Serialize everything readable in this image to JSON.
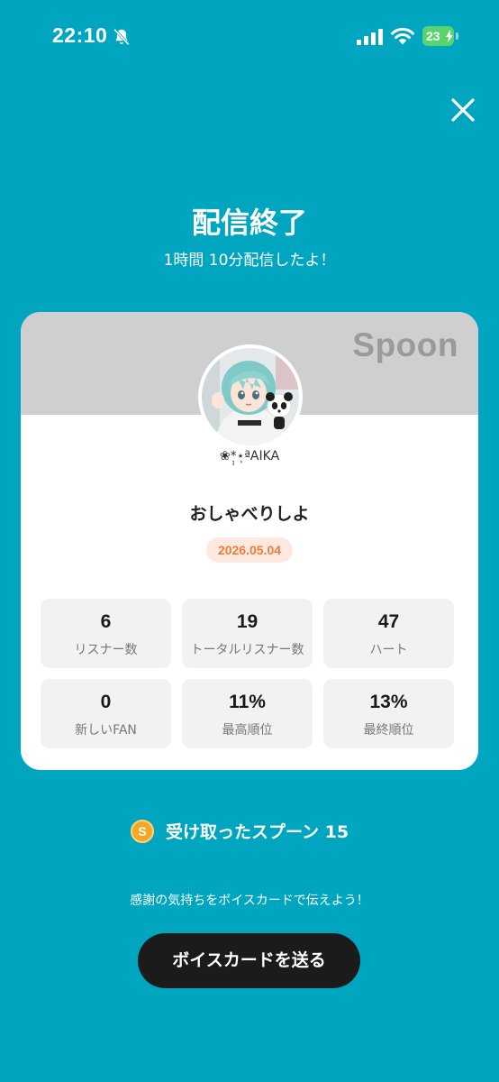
{
  "status_bar": {
    "time": "22:10",
    "battery": "23",
    "icons": [
      "bell-slash-icon",
      "signal-icon",
      "wifi-icon",
      "battery-charging-icon"
    ]
  },
  "close_icon": "close-icon",
  "header": {
    "title": "配信終了",
    "subtitle": "1時間 10分配信したよ！"
  },
  "card": {
    "brand": "Spoon",
    "username": "❀*̣̩⋆̩ªAIKA",
    "broadcast_title": "おしゃべりしよ",
    "date": "2026.05.04",
    "stats": [
      {
        "value": "6",
        "label": "リスナー数"
      },
      {
        "value": "19",
        "label": "トータルリスナー数"
      },
      {
        "value": "47",
        "label": "ハート"
      },
      {
        "value": "0",
        "label": "新しいFAN"
      },
      {
        "value": "11%",
        "label": "最高順位"
      },
      {
        "value": "13%",
        "label": "最終順位"
      }
    ]
  },
  "spoons": {
    "coin_letter": "S",
    "text": "受け取ったスプーン  15"
  },
  "thanks_text": "感謝の気持ちをボイスカードで伝えよう！",
  "voice_card_button": "ボイスカードを送る",
  "colors": {
    "background": "#00A5BF",
    "date_badge_text": "#f07a3c",
    "button": "#1b1b1b"
  }
}
